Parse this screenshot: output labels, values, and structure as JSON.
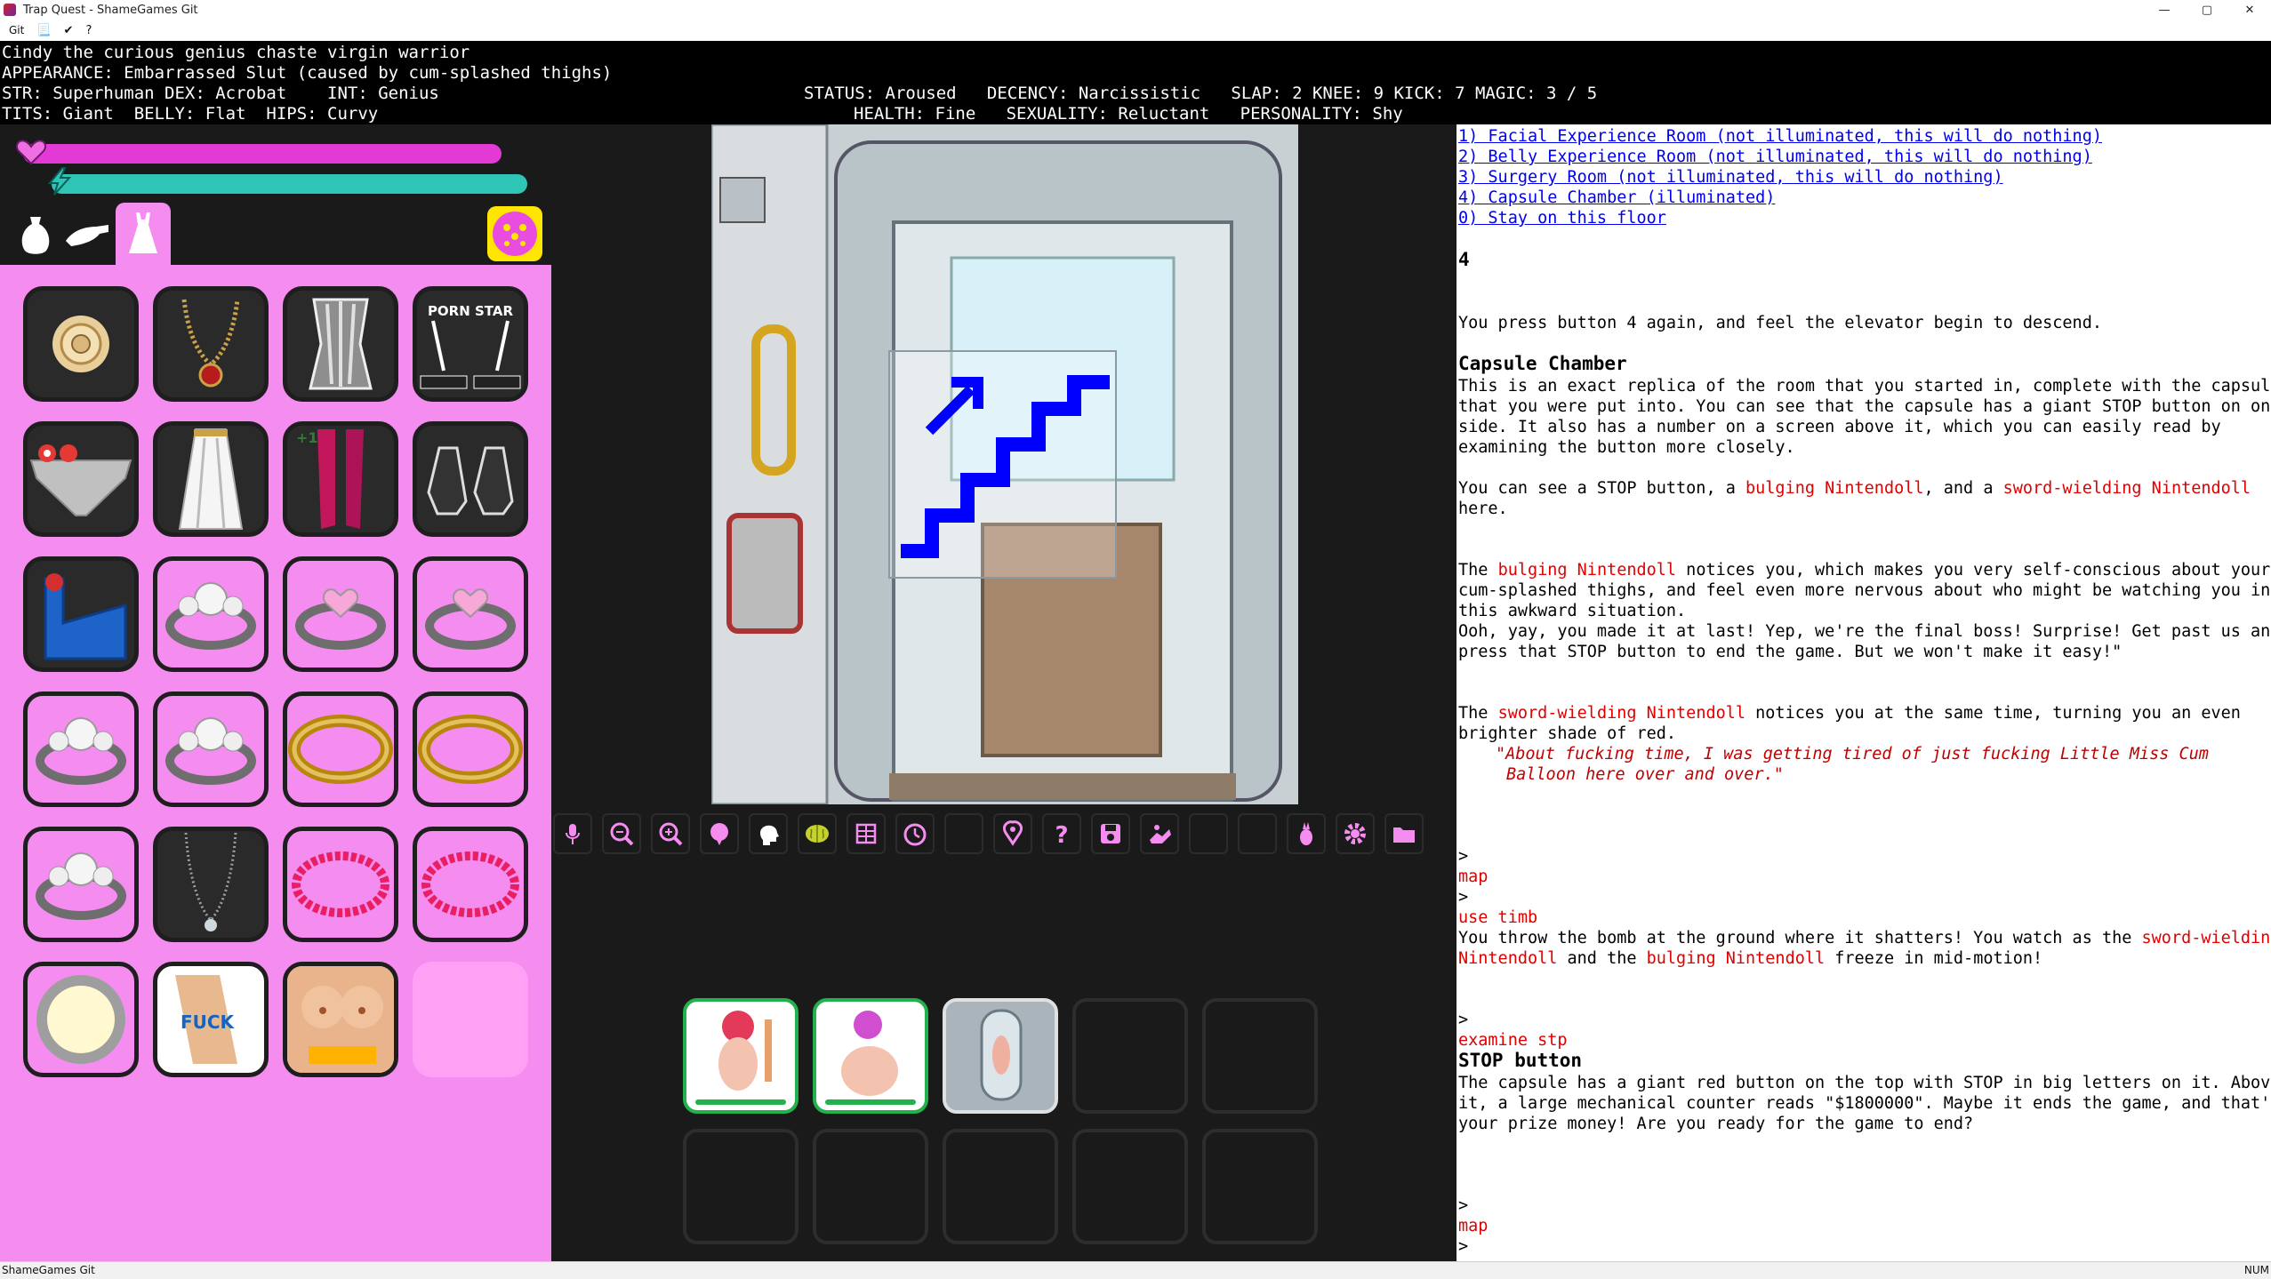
{
  "window": {
    "title": "Trap Quest - ShameGames Git",
    "menu": "Git",
    "controls": [
      "—",
      "▢",
      "✕"
    ]
  },
  "status": {
    "line1": "Cindy the curious genius chaste virgin warrior",
    "line2": "APPEARANCE: Embarrassed Slut (caused by cum-splashed thighs)",
    "line3_left": "STR: Superhuman DEX: Acrobat    INT: Genius",
    "line3_right": "STATUS: Aroused   DECENCY: Narcissistic   SLAP: 2 KNEE: 9 KICK: 7 MAGIC: 3 / 5",
    "line4_left": "TITS: Giant  BELLY: Flat  HIPS: Curvy",
    "line4_right": "HEALTH: Fine   SEXUALITY: Reluctant   PERSONALITY: Shy"
  },
  "left_panel": {
    "health_fill": 0.96,
    "energy_fill": 0.99,
    "colors": {
      "health": "#e33ad6",
      "energy": "#2ec4b6",
      "panel": "#f58cf0"
    },
    "tabs": [
      "bag-icon",
      "hand-icon",
      "dress-icon"
    ],
    "slots": [
      "rose-icon",
      "necklace-icon",
      "corset-icon",
      "porn-star-straps-icon",
      "panties-icon",
      "skirt-icon",
      "stockings-icon",
      "heels-icon",
      "blue-chip-icon",
      "diamond-ring-icon",
      "heart-ring-icon",
      "heart-ring-icon",
      "diamond-ring-icon",
      "diamond-ring-icon",
      "gold-ring-icon",
      "gold-ring-icon",
      "diamond-ring-icon",
      "pendant-icon",
      "bead-bracelet-icon",
      "bead-bracelet-icon",
      "plate-icon",
      "tattoo-icon",
      "body-tattoo-icon",
      "empty"
    ],
    "stocking_badge": "+1"
  },
  "toolbar": {
    "buttons": [
      "mic-icon",
      "zoom-out-icon",
      "zoom-in-icon",
      "bubble-icon",
      "head-icon",
      "brain-icon",
      "grid-icon",
      "timer-icon",
      "blank",
      "map-pin-icon",
      "help-icon",
      "save-icon",
      "hands-icon",
      "blank",
      "blank",
      "pineapple-icon",
      "settings-icon",
      "folder-icon"
    ]
  },
  "log": {
    "menu": [
      "1) Facial Experience Room (not illuminated, this will do nothing)",
      "2) Belly Experience Room (not illuminated, this will do nothing)",
      "3) Surgery Room (not illuminated, this will do nothing)",
      "4) Capsule Chamber (illuminated)",
      "0) Stay on this floor"
    ],
    "input_4": "4",
    "descend": "You press button 4 again, and feel the elevator begin to descend.",
    "room_title": "Capsule Chamber",
    "room_desc": [
      "This is an exact replica of the room that you started in, complete with the capsule",
      "that you were put into. You can see that the capsule has a giant STOP button on one",
      "side. It also has a number on a screen above it, which you can easily read by",
      "examining the button more closely."
    ],
    "see_a": "You can see a STOP button, a ",
    "bulging": "bulging Nintendoll",
    "see_b": ", and a ",
    "sword": "sword-wielding Nintendoll",
    "here": "here.",
    "bulging_a": "The ",
    "bulging_b": " notices you, which makes you very self-conscious about your",
    "bulging_c": "cum-splashed thighs, and feel even more nervous about who might be watching you in",
    "bulging_d": "this awkward situation.",
    "bulging_e": "Ooh, yay, you made it at last! Yep, we're the final boss! Surprise! Get past us and",
    "bulging_f": "press that STOP button to end the game. But we won't make it easy!\"",
    "sword_a": "The ",
    "sword_b": " notices you at the same time, turning you an even",
    "sword_c": "brighter shade of red.",
    "quote1": "\"About fucking time, I was getting tired of just fucking Little Miss Cum",
    "quote2": "Balloon here over and over.\"",
    "prompt": ">",
    "cmd_map": "map",
    "cmd_use": "use timb",
    "bomb_a": "You throw the bomb at the ground where it shatters! You watch as the ",
    "bomb_b": "Nintendoll",
    "bomb_c": " and the ",
    "bomb_d": " freeze in mid-motion!",
    "sword_word": "sword-wielding",
    "cmd_examine": "examine stp",
    "stop_title": "STOP button",
    "stop_desc": [
      "The capsule has a giant red button on the top with STOP in big letters on it. Above",
      "it, a large mechanical counter reads \"$1800000\". Maybe it ends the game, and that's",
      "your prize money! Are you ready for the game to end?"
    ]
  },
  "statusbar": {
    "left": "ShameGames Git",
    "right": "NUM"
  }
}
